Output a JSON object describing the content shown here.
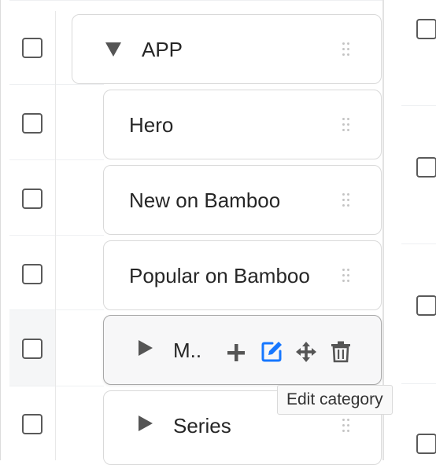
{
  "tree": {
    "nodes": [
      {
        "label": "APP",
        "expanded": true,
        "level": 0
      },
      {
        "label": "Hero",
        "level": 1
      },
      {
        "label": "New on Bamboo",
        "level": 1
      },
      {
        "label": "Popular on Bamboo",
        "level": 1
      },
      {
        "label": "M..",
        "level": 1,
        "collapsed": true,
        "hovered": true
      },
      {
        "label": "Series",
        "level": 1,
        "collapsed": true
      }
    ]
  },
  "actions": {
    "add": "plus-icon",
    "edit": "edit-icon",
    "move": "move-icon",
    "delete": "trash-icon"
  },
  "tooltip": {
    "text": "Edit category"
  },
  "colors": {
    "accent": "#1677ff",
    "hover_row": "#f5f6f7",
    "border": "#d9d9d9"
  }
}
